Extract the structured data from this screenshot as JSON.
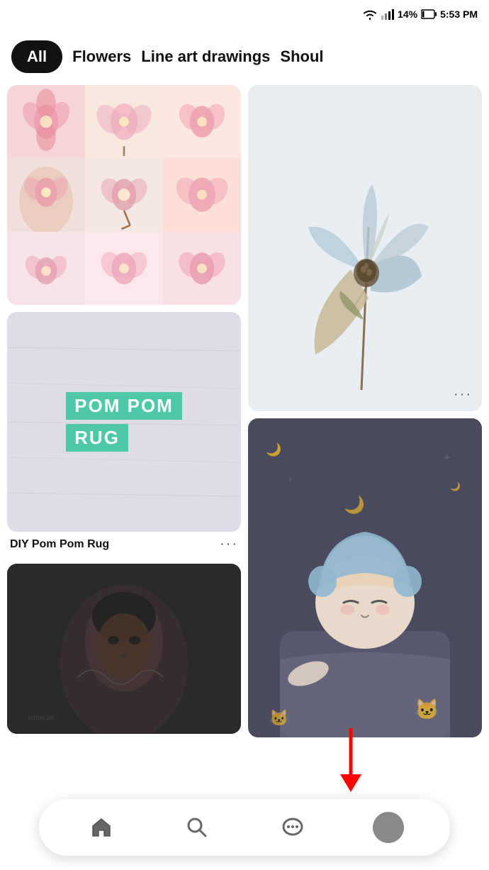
{
  "statusBar": {
    "time": "5:53 PM",
    "battery": "14%",
    "signal": "●●●"
  },
  "tabs": {
    "all": "All",
    "flowers": "Flowers",
    "lineArt": "Line art drawings",
    "shoulderPartial": "Shoul"
  },
  "cards": {
    "moreMenu": "···",
    "pomTitle1": "POM POM",
    "pomTitle2": "RUG",
    "cardLabel": "DIY Pom Pom Rug"
  },
  "nav": {
    "home": "⌂",
    "search": "🔍",
    "messages": "💬"
  }
}
